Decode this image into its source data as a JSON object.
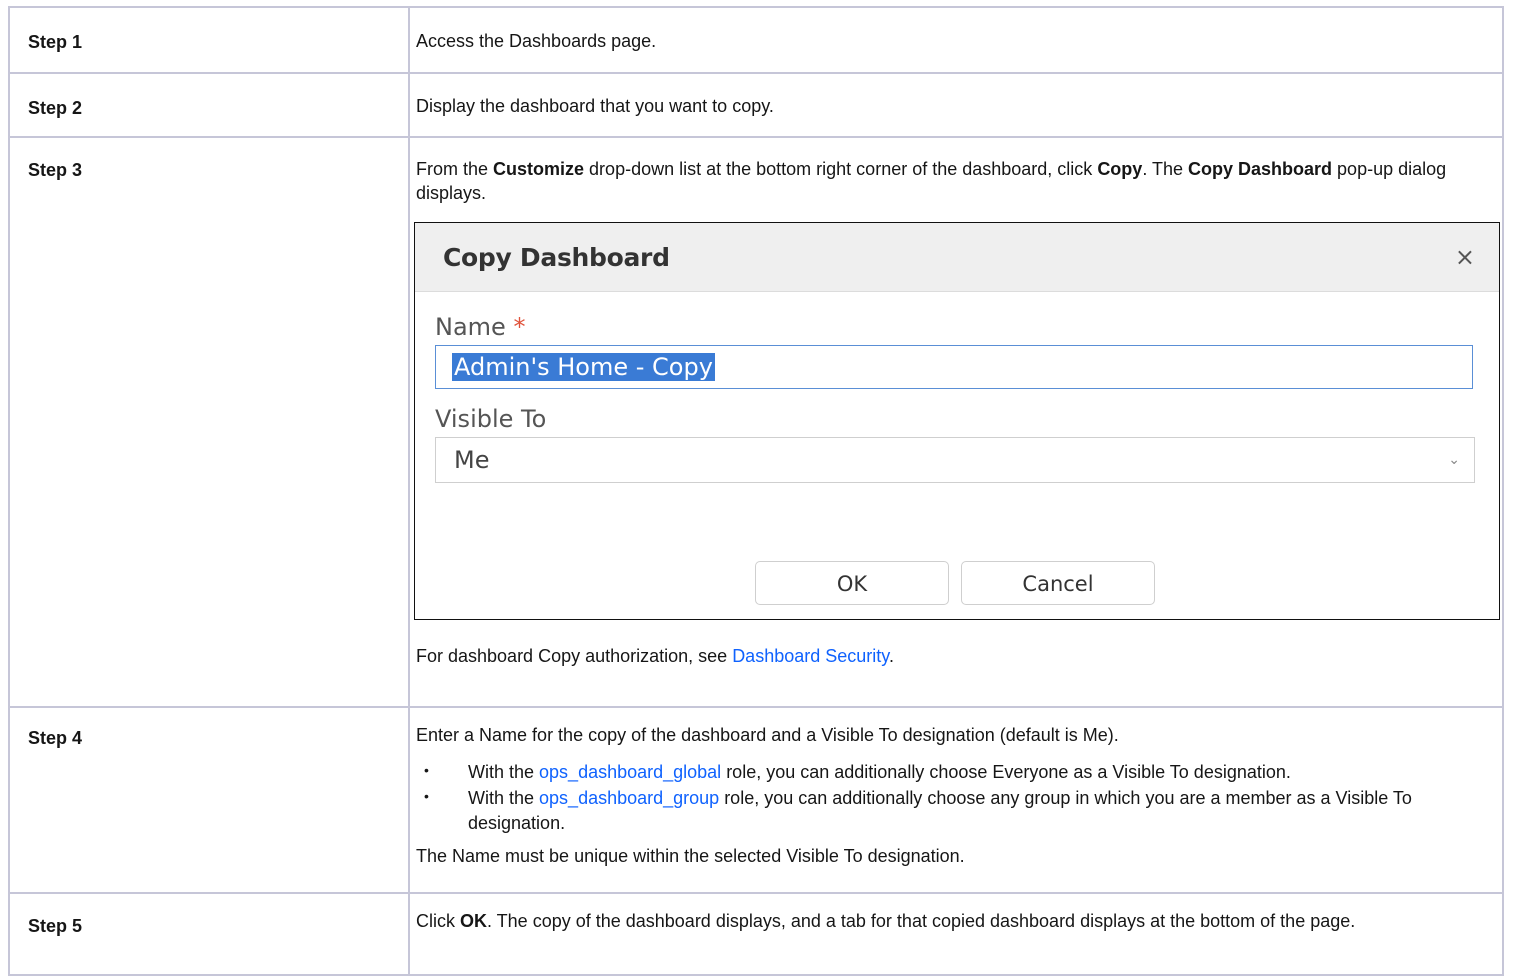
{
  "steps": [
    {
      "label": "Step 1",
      "text": "Access the Dashboards page."
    },
    {
      "label": "Step 2",
      "text": "Display the dashboard that you want to copy."
    },
    {
      "label": "Step 3",
      "t1": "From the ",
      "b1": "Customize",
      "t2": " drop-down list at the bottom right corner of the dashboard, click ",
      "b2": "Copy",
      "t3": ". The ",
      "b3": "Copy Dashboard",
      "t4": " pop-up dialog displays.",
      "after_text": "For dashboard Copy authorization, see ",
      "after_link": "Dashboard Security",
      "after_end": "."
    },
    {
      "label": "Step 4",
      "intro": "Enter a Name for the copy of the dashboard and a Visible To designation (default is Me).",
      "bullets": [
        {
          "pre": "With the ",
          "link": "ops_dashboard_global",
          "post": " role, you can additionally choose Everyone as a Visible To designation."
        },
        {
          "pre": "With the ",
          "link": "ops_dashboard_group",
          "post": " role, you can additionally choose any group in which you are a member as a Visible To designation."
        }
      ],
      "note": "The Name must be unique within the selected Visible To designation."
    },
    {
      "label": "Step 5",
      "t1": "Click ",
      "b1": "OK",
      "t2": ". The copy of the dashboard displays, and a tab for that copied dashboard displays at the bottom of the page."
    }
  ],
  "dialog": {
    "title": "Copy Dashboard",
    "close": "×",
    "name_label": "Name",
    "required_mark": "*",
    "name_value": "Admin's Home - Copy",
    "visible_label": "Visible To",
    "visible_value": "Me",
    "chevron": "⌄",
    "ok": "OK",
    "cancel": "Cancel"
  }
}
